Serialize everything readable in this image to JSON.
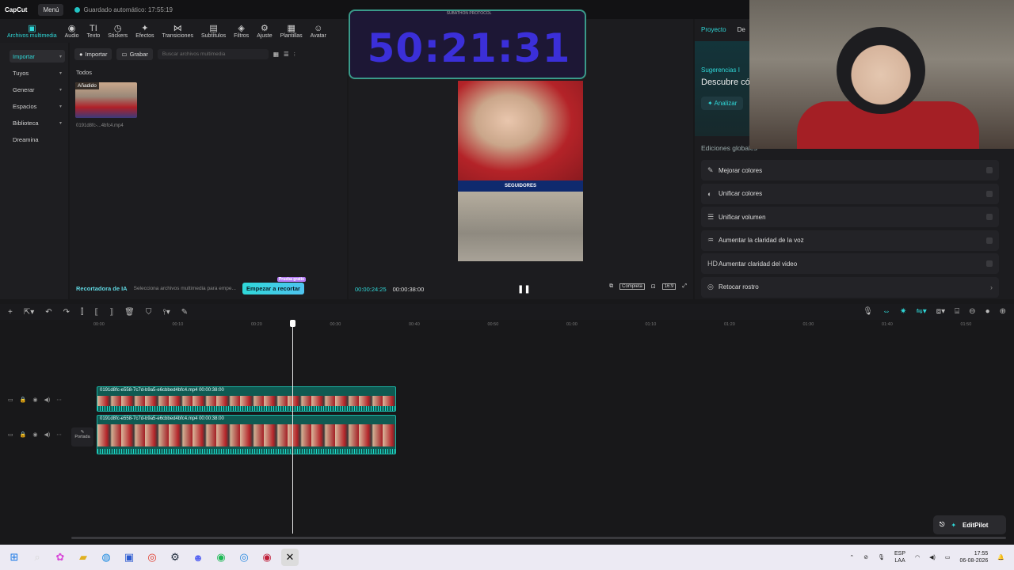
{
  "app": {
    "logo": "CapCut",
    "menu": "Menú",
    "autosave": "Guardado automático: 17:55:19"
  },
  "toolbar": [
    {
      "label": "Archivos multimedia",
      "icon": "media-icon",
      "glyph": "▣"
    },
    {
      "label": "Audio",
      "icon": "audio-icon",
      "glyph": "◉"
    },
    {
      "label": "Texto",
      "icon": "text-icon",
      "glyph": "TI"
    },
    {
      "label": "Stickers",
      "icon": "sticker-icon",
      "glyph": "◷"
    },
    {
      "label": "Efectos",
      "icon": "effects-icon",
      "glyph": "✦"
    },
    {
      "label": "Transiciones",
      "icon": "transition-icon",
      "glyph": "⋈"
    },
    {
      "label": "Subtítulos",
      "icon": "subtitle-icon",
      "glyph": "▤"
    },
    {
      "label": "Filtros",
      "icon": "filter-icon",
      "glyph": "◈"
    },
    {
      "label": "Ajuste",
      "icon": "adjust-icon",
      "glyph": "⚙"
    },
    {
      "label": "Plantillas",
      "icon": "template-icon",
      "glyph": "▦"
    },
    {
      "label": "Avatar",
      "icon": "avatar-icon",
      "glyph": "☺"
    }
  ],
  "leftnav": [
    {
      "label": "Importar",
      "chev": true
    },
    {
      "label": "Tuyos",
      "chev": true
    },
    {
      "label": "Generar",
      "chev": true
    },
    {
      "label": "Espacios",
      "chev": true
    },
    {
      "label": "Biblioteca",
      "chev": true
    },
    {
      "label": "Dreamina",
      "chev": false
    }
  ],
  "media": {
    "import_btn": "Importar",
    "record_btn": "Grabar",
    "search_placeholder": "Buscar archivos multimedia",
    "section": "Todos",
    "thumb_badge": "Añadido",
    "thumb_name": "0191d8fc-...4bfc4.mp4",
    "ai_recorder": "Recortadora de IA",
    "ai_hint": "Selecciona archivos multimedia para empe...",
    "start_btn": "Empezar a recortar",
    "start_tag": "Prueba gratis"
  },
  "preview": {
    "timer_label": "SUBATHON PROTOCOL",
    "timer": "50:21:31",
    "banner": "SEGUIDORES",
    "tc_current": "00:00:24:25",
    "tc_total": "00:00:38:00",
    "full_label": "Completa",
    "ratio_label": "16:9"
  },
  "right": {
    "tab_project": "Proyecto",
    "tab_detail": "De",
    "sug_title": "Sugerencias I",
    "sug_sub": "Descubre có",
    "analyze": "Analizar",
    "edits_title": "Ediciones globales",
    "rows": [
      {
        "label": "Mejorar colores",
        "glyph": "✎",
        "end": "sq"
      },
      {
        "label": "Unificar colores",
        "glyph": "◐",
        "end": "sq"
      },
      {
        "label": "Unificar volumen",
        "glyph": "☰",
        "end": "sq"
      },
      {
        "label": "Aumentar la claridad de la voz",
        "glyph": "♒",
        "end": "sq"
      },
      {
        "label": "Aumentar claridad del video",
        "glyph": "HD",
        "end": "sq"
      },
      {
        "label": "Retocar rostro",
        "glyph": "◎",
        "end": "arr"
      }
    ]
  },
  "timeline": {
    "ruler": [
      "00:00",
      "00:10",
      "00:20",
      "00:30",
      "00:40",
      "00:50",
      "01:00",
      "01:10",
      "01:20",
      "01:30",
      "01:40",
      "01:50"
    ],
    "cover": "Portada",
    "clip1": "0191d8fc-e558-7c7d-b9a5-e6cbbed4bfc4.mp4  00:00:38:00",
    "clip2": "0191d8fc-e558-7c7d-b9a5-e6cbbed4bfc4.mp4  00:00:38:00",
    "editpilot": "EditPilot"
  },
  "taskbar": {
    "lang1": "ESP",
    "lang2": "LAA",
    "time": "17:55",
    "date": "06-08-2026"
  }
}
